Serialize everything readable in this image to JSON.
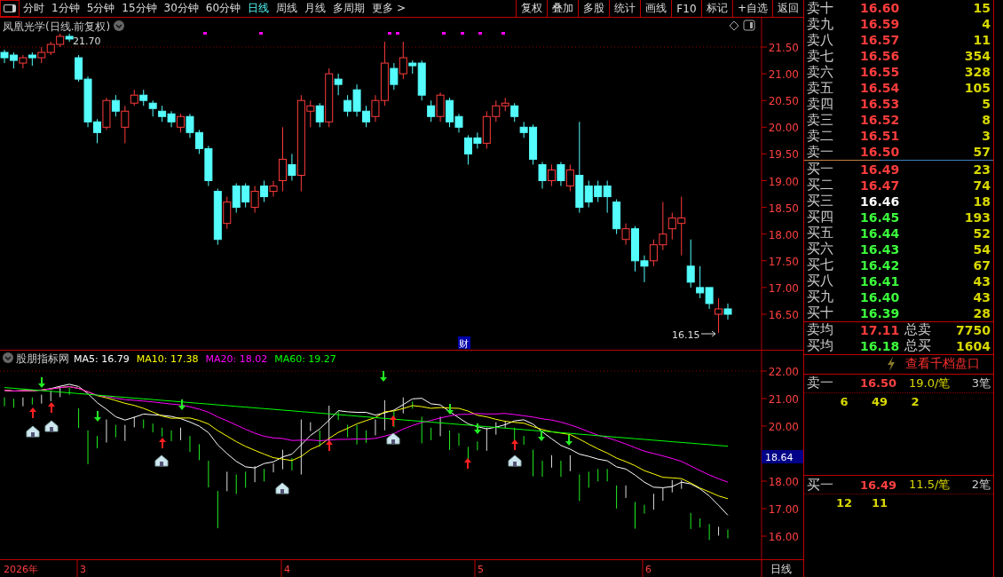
{
  "toolbar": {
    "periods": [
      {
        "label": "分时",
        "selected": false
      },
      {
        "label": "1分钟",
        "selected": false
      },
      {
        "label": "5分钟",
        "selected": false
      },
      {
        "label": "15分钟",
        "selected": false
      },
      {
        "label": "30分钟",
        "selected": false
      },
      {
        "label": "60分钟",
        "selected": false
      },
      {
        "label": "日线",
        "selected": true
      },
      {
        "label": "周线",
        "selected": false
      },
      {
        "label": "月线",
        "selected": false
      },
      {
        "label": "多周期",
        "selected": false
      },
      {
        "label": "更多 >",
        "selected": false
      }
    ],
    "buttons": [
      "复权",
      "叠加",
      "多股",
      "统计",
      "画线",
      "F10",
      "标记",
      "+自选",
      "返回"
    ]
  },
  "chart": {
    "title": "凤凰光学(日线.前复权)",
    "high_label": "21.70",
    "low_label": "16.15",
    "marker": "财",
    "price_ticks": [
      "21.50",
      "21.00",
      "20.50",
      "20.00",
      "19.50",
      "19.00",
      "18.50",
      "18.00",
      "17.50",
      "17.00",
      "16.50"
    ]
  },
  "indicator": {
    "name": "股朋指标网",
    "current": "18.64",
    "ma": [
      {
        "label": "MA5: 16.79",
        "color": "#ffffff"
      },
      {
        "label": "MA10: 17.38",
        "color": "#ffff00"
      },
      {
        "label": "MA20: 18.02",
        "color": "#ff00ff"
      },
      {
        "label": "MA60: 19.27",
        "color": "#00ff00"
      }
    ],
    "ticks": [
      "22.00",
      "21.00",
      "20.00",
      "18.00",
      "17.00",
      "16.00"
    ]
  },
  "x_axis": {
    "labels": [
      "2026年",
      "3",
      "4",
      "5",
      "6"
    ],
    "period": "日线"
  },
  "order_book": {
    "asks": [
      {
        "label": "卖十",
        "price": "16.60",
        "volume": "15",
        "color": "#ff3c3c"
      },
      {
        "label": "卖九",
        "price": "16.59",
        "volume": "4",
        "color": "#ff3c3c"
      },
      {
        "label": "卖八",
        "price": "16.57",
        "volume": "11",
        "color": "#ff3c3c"
      },
      {
        "label": "卖七",
        "price": "16.56",
        "volume": "354",
        "color": "#ff3c3c"
      },
      {
        "label": "卖六",
        "price": "16.55",
        "volume": "328",
        "color": "#ff3c3c"
      },
      {
        "label": "卖五",
        "price": "16.54",
        "volume": "105",
        "color": "#ff3c3c"
      },
      {
        "label": "卖四",
        "price": "16.53",
        "volume": "5",
        "color": "#ff3c3c"
      },
      {
        "label": "卖三",
        "price": "16.52",
        "volume": "8",
        "color": "#ff3c3c"
      },
      {
        "label": "卖二",
        "price": "16.51",
        "volume": "3",
        "color": "#ff3c3c"
      },
      {
        "label": "卖一",
        "price": "16.50",
        "volume": "57",
        "color": "#ff3c3c"
      }
    ],
    "bids": [
      {
        "label": "买一",
        "price": "16.49",
        "volume": "23",
        "color": "#ff3c3c"
      },
      {
        "label": "买二",
        "price": "16.47",
        "volume": "74",
        "color": "#ff3c3c"
      },
      {
        "label": "买三",
        "price": "16.46",
        "volume": "18",
        "color": "#ffffff"
      },
      {
        "label": "买四",
        "price": "16.45",
        "volume": "193",
        "color": "#3cff3c"
      },
      {
        "label": "买五",
        "price": "16.44",
        "volume": "52",
        "color": "#3cff3c"
      },
      {
        "label": "买六",
        "price": "16.43",
        "volume": "54",
        "color": "#3cff3c"
      },
      {
        "label": "买七",
        "price": "16.42",
        "volume": "67",
        "color": "#3cff3c"
      },
      {
        "label": "买八",
        "price": "16.41",
        "volume": "43",
        "color": "#3cff3c"
      },
      {
        "label": "买九",
        "price": "16.40",
        "volume": "43",
        "color": "#3cff3c"
      },
      {
        "label": "买十",
        "price": "16.39",
        "volume": "28",
        "color": "#3cff3c"
      }
    ],
    "summary": [
      {
        "label": "卖均",
        "price": "17.11",
        "color": "#ff3c3c",
        "total_label": "总卖",
        "total": "7750"
      },
      {
        "label": "买均",
        "price": "16.18",
        "color": "#3cff3c",
        "total_label": "总买",
        "total": "1604"
      }
    ],
    "depth_link": "查看千档盘口",
    "queues": [
      {
        "label": "卖一",
        "price": "16.50",
        "average": "19.0/笔",
        "count": "3笔",
        "orders": [
          "6",
          "49",
          "2"
        ]
      },
      {
        "label": "买一",
        "price": "16.49",
        "average": "11.5/笔",
        "count": "2笔",
        "orders": [
          "12",
          "11"
        ]
      }
    ]
  }
}
